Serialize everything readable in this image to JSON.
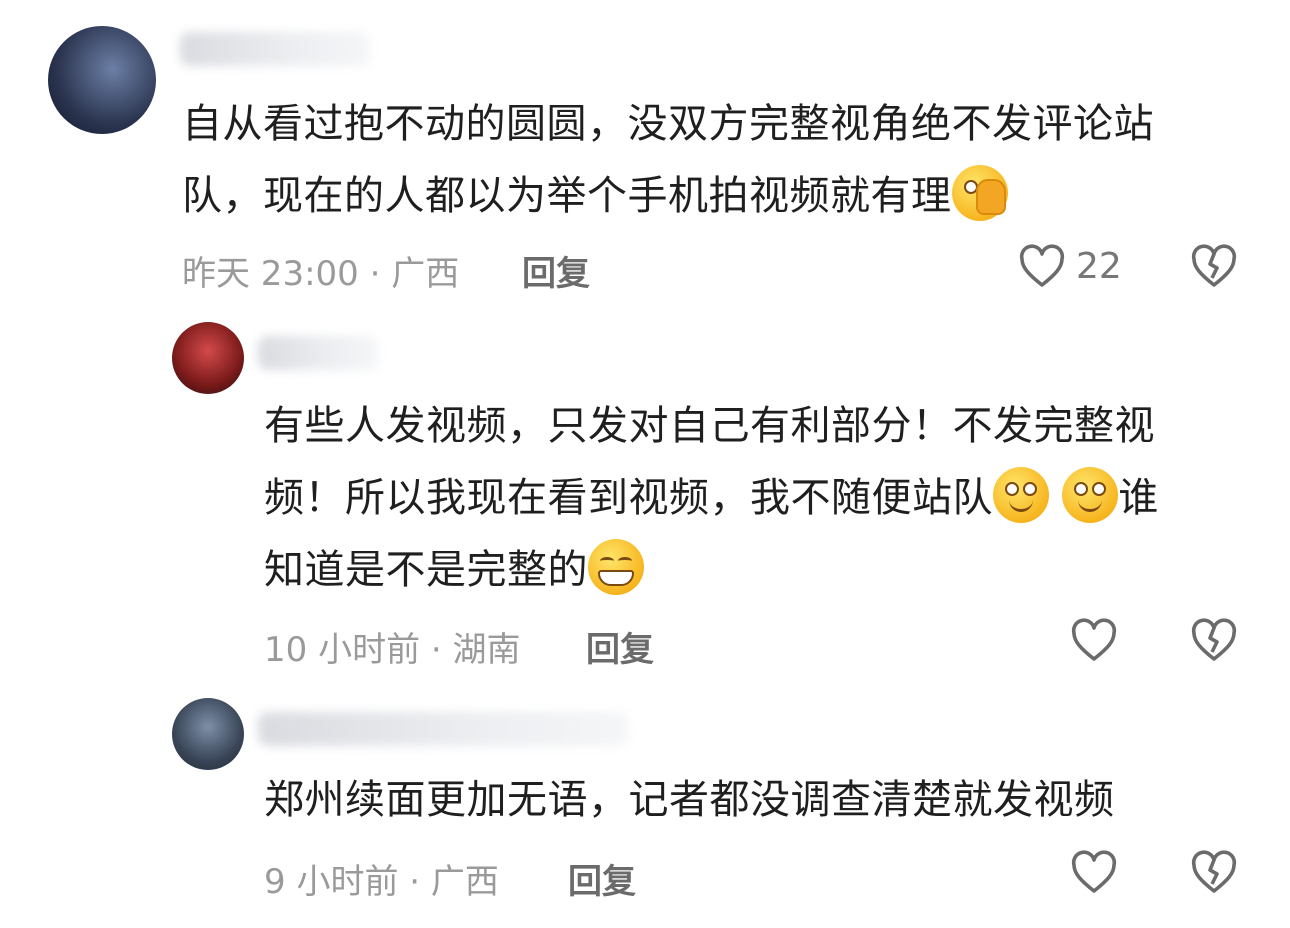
{
  "comments": [
    {
      "text_line1": "自从看过抱不动的圆圆，没双方完整视角绝不发评论站",
      "text_line2": "队，现在的人都以为举个手机拍视频就有理",
      "time_location": "昨天 23:00 · 广西",
      "reply_label": "回复",
      "like_count": "22",
      "emoji": "facepalm-emoji"
    },
    {
      "text_line1": "有些人发视频，只发对自己有利部分！不发完整视",
      "text_line2_a": "频！所以我现在看到视频，我不随便站队",
      "text_line2_b": "谁",
      "text_line3": "知道是不是完整的",
      "time_location": "10 小时前 · 湖南",
      "reply_label": "回复",
      "emoji": [
        "smile-emoji",
        "smile-emoji",
        "grin-emoji"
      ]
    },
    {
      "text_line1": "郑州续面更加无语，记者都没调查清楚就发视频",
      "time_location": "9 小时前 · 广西",
      "reply_label": "回复"
    }
  ],
  "icons": {
    "like": "heart-outline-icon",
    "dislike": "broken-heart-icon"
  },
  "colors": {
    "text": "#1f1f1f",
    "meta": "#9a9a9a",
    "icon": "#6b6b6b"
  }
}
